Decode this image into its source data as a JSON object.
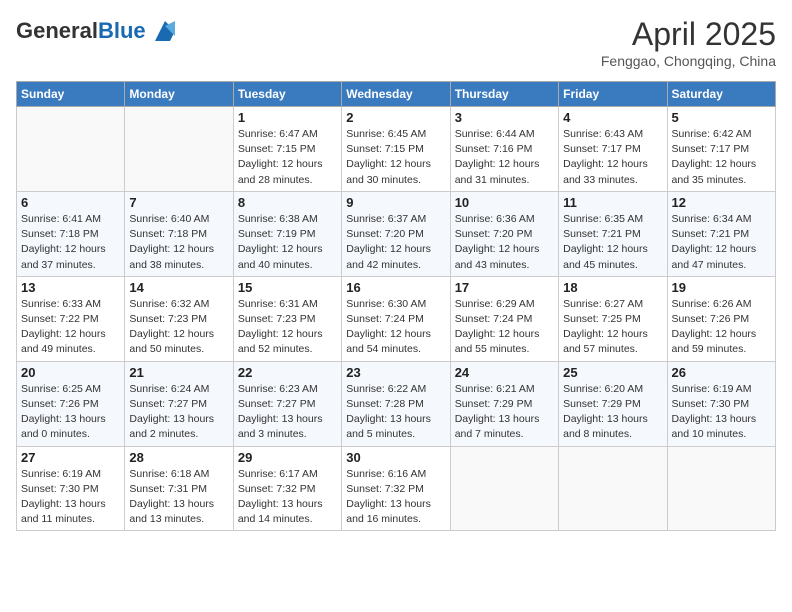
{
  "logo": {
    "general": "General",
    "blue": "Blue"
  },
  "title": "April 2025",
  "subtitle": "Fenggao, Chongqing, China",
  "days_of_week": [
    "Sunday",
    "Monday",
    "Tuesday",
    "Wednesday",
    "Thursday",
    "Friday",
    "Saturday"
  ],
  "weeks": [
    [
      {
        "day": "",
        "info": ""
      },
      {
        "day": "",
        "info": ""
      },
      {
        "day": "1",
        "info": "Sunrise: 6:47 AM\nSunset: 7:15 PM\nDaylight: 12 hours and 28 minutes."
      },
      {
        "day": "2",
        "info": "Sunrise: 6:45 AM\nSunset: 7:15 PM\nDaylight: 12 hours and 30 minutes."
      },
      {
        "day": "3",
        "info": "Sunrise: 6:44 AM\nSunset: 7:16 PM\nDaylight: 12 hours and 31 minutes."
      },
      {
        "day": "4",
        "info": "Sunrise: 6:43 AM\nSunset: 7:17 PM\nDaylight: 12 hours and 33 minutes."
      },
      {
        "day": "5",
        "info": "Sunrise: 6:42 AM\nSunset: 7:17 PM\nDaylight: 12 hours and 35 minutes."
      }
    ],
    [
      {
        "day": "6",
        "info": "Sunrise: 6:41 AM\nSunset: 7:18 PM\nDaylight: 12 hours and 37 minutes."
      },
      {
        "day": "7",
        "info": "Sunrise: 6:40 AM\nSunset: 7:18 PM\nDaylight: 12 hours and 38 minutes."
      },
      {
        "day": "8",
        "info": "Sunrise: 6:38 AM\nSunset: 7:19 PM\nDaylight: 12 hours and 40 minutes."
      },
      {
        "day": "9",
        "info": "Sunrise: 6:37 AM\nSunset: 7:20 PM\nDaylight: 12 hours and 42 minutes."
      },
      {
        "day": "10",
        "info": "Sunrise: 6:36 AM\nSunset: 7:20 PM\nDaylight: 12 hours and 43 minutes."
      },
      {
        "day": "11",
        "info": "Sunrise: 6:35 AM\nSunset: 7:21 PM\nDaylight: 12 hours and 45 minutes."
      },
      {
        "day": "12",
        "info": "Sunrise: 6:34 AM\nSunset: 7:21 PM\nDaylight: 12 hours and 47 minutes."
      }
    ],
    [
      {
        "day": "13",
        "info": "Sunrise: 6:33 AM\nSunset: 7:22 PM\nDaylight: 12 hours and 49 minutes."
      },
      {
        "day": "14",
        "info": "Sunrise: 6:32 AM\nSunset: 7:23 PM\nDaylight: 12 hours and 50 minutes."
      },
      {
        "day": "15",
        "info": "Sunrise: 6:31 AM\nSunset: 7:23 PM\nDaylight: 12 hours and 52 minutes."
      },
      {
        "day": "16",
        "info": "Sunrise: 6:30 AM\nSunset: 7:24 PM\nDaylight: 12 hours and 54 minutes."
      },
      {
        "day": "17",
        "info": "Sunrise: 6:29 AM\nSunset: 7:24 PM\nDaylight: 12 hours and 55 minutes."
      },
      {
        "day": "18",
        "info": "Sunrise: 6:27 AM\nSunset: 7:25 PM\nDaylight: 12 hours and 57 minutes."
      },
      {
        "day": "19",
        "info": "Sunrise: 6:26 AM\nSunset: 7:26 PM\nDaylight: 12 hours and 59 minutes."
      }
    ],
    [
      {
        "day": "20",
        "info": "Sunrise: 6:25 AM\nSunset: 7:26 PM\nDaylight: 13 hours and 0 minutes."
      },
      {
        "day": "21",
        "info": "Sunrise: 6:24 AM\nSunset: 7:27 PM\nDaylight: 13 hours and 2 minutes."
      },
      {
        "day": "22",
        "info": "Sunrise: 6:23 AM\nSunset: 7:27 PM\nDaylight: 13 hours and 3 minutes."
      },
      {
        "day": "23",
        "info": "Sunrise: 6:22 AM\nSunset: 7:28 PM\nDaylight: 13 hours and 5 minutes."
      },
      {
        "day": "24",
        "info": "Sunrise: 6:21 AM\nSunset: 7:29 PM\nDaylight: 13 hours and 7 minutes."
      },
      {
        "day": "25",
        "info": "Sunrise: 6:20 AM\nSunset: 7:29 PM\nDaylight: 13 hours and 8 minutes."
      },
      {
        "day": "26",
        "info": "Sunrise: 6:19 AM\nSunset: 7:30 PM\nDaylight: 13 hours and 10 minutes."
      }
    ],
    [
      {
        "day": "27",
        "info": "Sunrise: 6:19 AM\nSunset: 7:30 PM\nDaylight: 13 hours and 11 minutes."
      },
      {
        "day": "28",
        "info": "Sunrise: 6:18 AM\nSunset: 7:31 PM\nDaylight: 13 hours and 13 minutes."
      },
      {
        "day": "29",
        "info": "Sunrise: 6:17 AM\nSunset: 7:32 PM\nDaylight: 13 hours and 14 minutes."
      },
      {
        "day": "30",
        "info": "Sunrise: 6:16 AM\nSunset: 7:32 PM\nDaylight: 13 hours and 16 minutes."
      },
      {
        "day": "",
        "info": ""
      },
      {
        "day": "",
        "info": ""
      },
      {
        "day": "",
        "info": ""
      }
    ]
  ]
}
